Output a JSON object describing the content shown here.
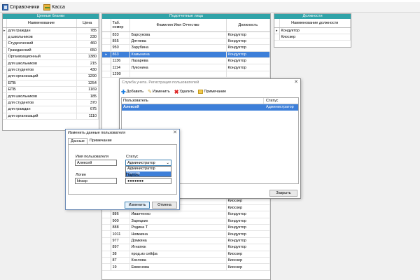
{
  "toolbar": {
    "ref_label": "Справочники",
    "cash_label": "Касса"
  },
  "forms": {
    "header": "Ценные бланки",
    "col_name": "Наименование",
    "col_price": "Цена",
    "rows": [
      {
        "name": "для граждан",
        "price": "785"
      },
      {
        "name": "д школьников",
        "price": "230"
      },
      {
        "name": "Студенческий",
        "price": "460"
      },
      {
        "name": "Гражданский",
        "price": "650"
      },
      {
        "name": "Организационный",
        "price": "1380"
      },
      {
        "name": "для школьников",
        "price": "215"
      },
      {
        "name": "для студентов",
        "price": "430"
      },
      {
        "name": "для организаций",
        "price": "1290"
      },
      {
        "name": "ЕПБ",
        "price": "1254"
      },
      {
        "name": "ЕПБ",
        "price": "1169"
      },
      {
        "name": "для школьников",
        "price": "185"
      },
      {
        "name": "для студентов",
        "price": "370"
      },
      {
        "name": "для граждан",
        "price": "675"
      },
      {
        "name": "для организаций",
        "price": "1110"
      }
    ]
  },
  "persons": {
    "header": "Подотчетные лица",
    "col_tab": "Таб. номер",
    "col_fio": "Фамилия Имя Отчество",
    "col_pos": "Должность",
    "rows_top": [
      {
        "tab": "833",
        "fio": "Барсукова",
        "pos": "Кондуктор",
        "sel": false
      },
      {
        "tab": "855",
        "fio": "Дятлева",
        "pos": "Кондуктор",
        "sel": false
      },
      {
        "tab": "950",
        "fio": "Зарубина",
        "pos": "Кондуктор",
        "sel": false
      },
      {
        "tab": "863",
        "fio": "Камынина",
        "pos": "Кондуктор",
        "sel": true
      },
      {
        "tab": "1136",
        "fio": "Лазарева",
        "pos": "Кондуктор",
        "sel": false
      },
      {
        "tab": "1114",
        "fio": "Луконина",
        "pos": "Кондуктор",
        "sel": false
      },
      {
        "tab": "1290",
        "fio": "",
        "pos": "",
        "sel": false
      }
    ],
    "rows_bottom": [
      {
        "tab": "",
        "fio": "",
        "pos": "Киоскер"
      },
      {
        "tab": "",
        "fio": "",
        "pos": "Киоскер"
      },
      {
        "tab": "886",
        "fio": "Иванченко",
        "pos": "Кондуктор"
      },
      {
        "tab": "900",
        "fio": "Зарецких",
        "pos": "Кондуктор"
      },
      {
        "tab": "888",
        "fio": "Родина Т",
        "pos": "Кондуктор"
      },
      {
        "tab": "1011",
        "fio": "Нюмкина",
        "pos": "Кондуктор"
      },
      {
        "tab": "977",
        "fio": "Домкина",
        "pos": "Кондуктор"
      },
      {
        "tab": "897",
        "fio": "Игнатюк",
        "pos": "Кондуктор"
      },
      {
        "tab": "38",
        "fio": "прод.из сейфа",
        "pos": "Киоскер"
      },
      {
        "tab": "87",
        "fio": "Кислова",
        "pos": "Киоскер"
      },
      {
        "tab": "19",
        "fio": "Евменова",
        "pos": "Киоскер"
      }
    ]
  },
  "positions": {
    "header": "Должности",
    "col_name": "Наименование должности",
    "rows": [
      "Кондуктор",
      "Киоскер"
    ]
  },
  "users_dialog": {
    "title": "Служба учета. Регистрация пользователей",
    "add": "Добавить",
    "edit": "Изменить",
    "delete": "Удалить",
    "note": "Примечание",
    "col_user": "Пользователь",
    "col_status": "Статус",
    "rows": [
      {
        "user": "Алексей",
        "status": "Администратор"
      }
    ],
    "close": "Закрыть"
  },
  "edit_dialog": {
    "title": "Изменить данные пользователя",
    "tab_data": "Данные",
    "tab_note": "Примечание",
    "lbl_username": "Имя пользователя",
    "username": "Алексей",
    "lbl_status": "Статус",
    "status": "Администратор",
    "status_options": [
      "Администратор",
      "Кассир"
    ],
    "lbl_login": "Логин",
    "login": "ktrasp",
    "lbl_password": "Пароль",
    "password": "●●●●●●●",
    "ok": "Изменить",
    "cancel": "Отмена"
  }
}
